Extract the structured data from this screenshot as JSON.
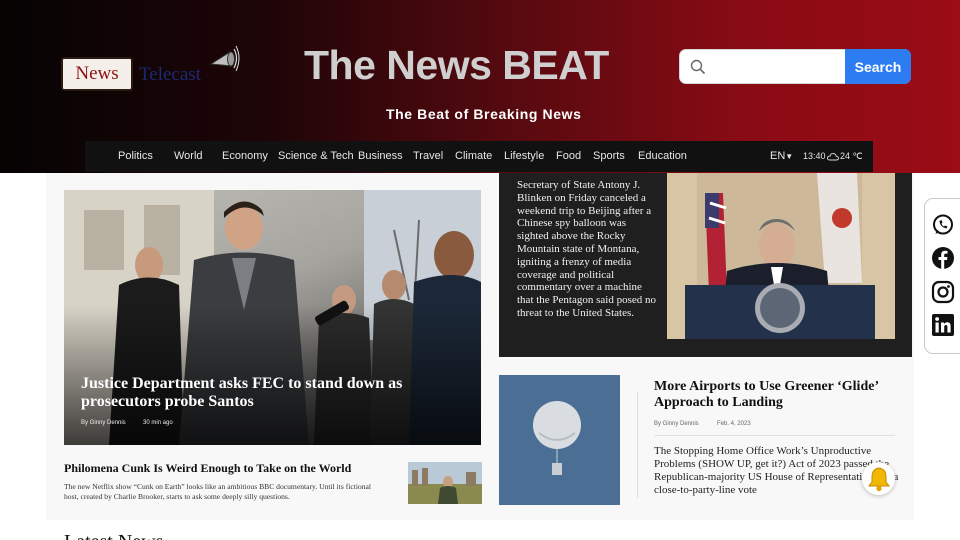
{
  "header": {
    "logo_word": "News",
    "logo_sub": "Telecast",
    "site_title": "The News BEAT",
    "tagline": "The Beat of Breaking News"
  },
  "search": {
    "placeholder": "",
    "button_label": "Search"
  },
  "nav": {
    "items": [
      "Politics",
      "World",
      "Economy",
      "Science & Tech",
      "Business",
      "Travel",
      "Climate",
      "Lifestyle",
      "Food",
      "Sports",
      "Education"
    ],
    "language": "EN",
    "time": "13:40",
    "temperature": "24 ℃"
  },
  "lead_story": {
    "title": "Justice Department asks FEC to stand down as prosecutors probe Santos",
    "author": "By Ginny Dennis",
    "time_ago": "30 min ago"
  },
  "secondary_story": {
    "title": "Philomena Cunk Is Weird Enough to Take on the World",
    "description": "The new Netflix show “Cunk on Earth” looks like an ambitious BBC documentary. Until its fictional host, created by Charlie Brooker, starts to ask some deeply silly questions."
  },
  "feature_story": {
    "text": "Secretary of State Antony J. Blinken on Friday canceled a weekend trip to Beijing after a Chinese spy balloon was sighted above the Rocky Mountain state of Montana, igniting a frenzy of media coverage and political commentary over a machine that the Pentagon said posed no threat to the United States."
  },
  "airports_story": {
    "title": "More Airports to Use Greener ‘Glide’ Approach to Landing",
    "author": "By Ginny Dennis",
    "date": "Feb. 4, 2023",
    "body": "The Stopping Home Office Work’s Unproductive Problems (SHOW UP, get it?) Act of 2023 passed the Republican-majority US House of Representatives on a close-to-party-line vote"
  },
  "share": {
    "icons": [
      "whatsapp-icon",
      "facebook-icon",
      "instagram-icon",
      "linkedin-icon"
    ]
  },
  "latest": {
    "heading": "Latest News"
  },
  "colors": {
    "accent": "#2d7cf2",
    "header_red": "#9a0c16",
    "nav_bg": "#111111",
    "bell": "#f2b705"
  }
}
